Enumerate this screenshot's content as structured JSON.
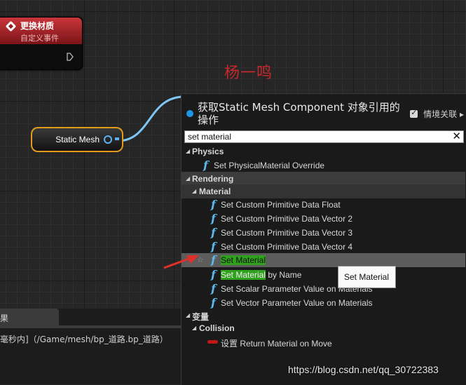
{
  "event_node": {
    "title": "更换材质",
    "subtitle": "自定义事件"
  },
  "mesh_node": {
    "label": "Static Mesh"
  },
  "annotation": {
    "author_text": "杨一鸣"
  },
  "bottom_panel": {
    "tab_label": "果",
    "log_text": "毫秒内]（/Game/mesh/bp_道路.bp_道路）"
  },
  "action_menu": {
    "title": "获取Static Mesh Component 对象引用的操作",
    "context_sensitive_label": "情境关联",
    "context_sensitive_checked": true,
    "search": {
      "value": "set material",
      "clear_glyph": "✕"
    },
    "categories": {
      "physics": "Physics",
      "rendering": "Rendering",
      "material": "Material",
      "variables": "变量",
      "collision": "Collision"
    },
    "items": {
      "physics_0": "Set PhysicalMaterial Override",
      "mat_0": "Set Custom Primitive Data Float",
      "mat_1": "Set Custom Primitive Data Vector 2",
      "mat_2": "Set Custom Primitive Data Vector 3",
      "mat_3": "Set Custom Primitive Data Vector 4",
      "mat_4": "Set Material",
      "mat_5_match": "Set Material",
      "mat_5_rest": " by Name",
      "mat_6": "Set Scalar Parameter Value on Materials",
      "mat_7": "Set Vector Parameter Value on Materials",
      "collision_0": "设置 Return Material on Move"
    },
    "selected_item": "Set Material",
    "highlight_color": "#2fa11c",
    "accent_color": "#1e96e6",
    "function_icon_glyph": "f"
  },
  "tooltip": {
    "text": "Set Material"
  },
  "watermark": {
    "text": "https://blog.csdn.net/qq_30722383"
  }
}
